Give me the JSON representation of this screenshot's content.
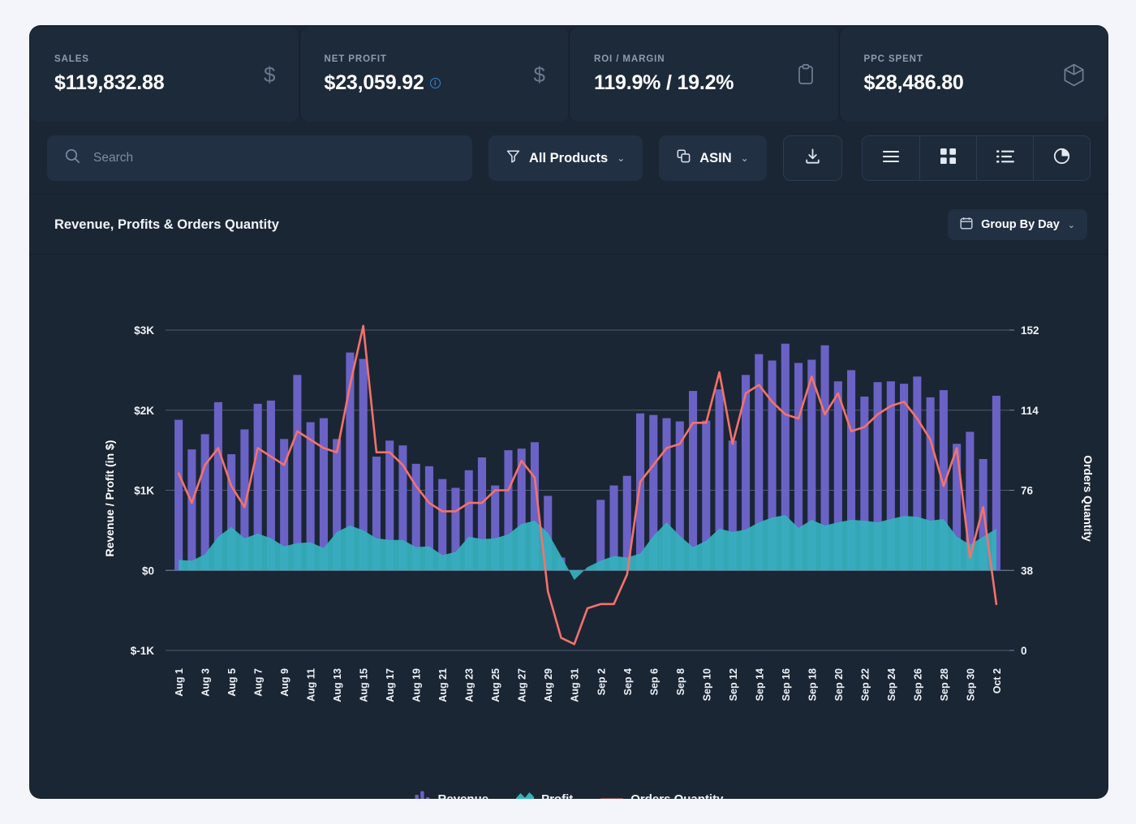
{
  "kpis": [
    {
      "label": "SALES",
      "value": "$119,832.88",
      "icon": "dollar-icon",
      "info": false
    },
    {
      "label": "NET PROFIT",
      "value": "$23,059.92",
      "icon": "dollar-icon",
      "info": true,
      "info_glyph": "i"
    },
    {
      "label": "ROI / MARGIN",
      "value": "119.9% / 19.2%",
      "icon": "clipboard-icon",
      "info": false
    },
    {
      "label": "PPC SPENT",
      "value": "$28,486.80",
      "icon": "box-icon",
      "info": false
    }
  ],
  "toolbar": {
    "search_placeholder": "Search",
    "search_value": "",
    "products_filter": "All Products",
    "asin_filter": "ASIN",
    "chevron": "⌄",
    "download_label": "Download",
    "views": [
      "list-view",
      "grid-view",
      "detail-list-view",
      "pie-chart-view"
    ]
  },
  "chart_header": {
    "title": "Revenue, Profits & Orders Quantity",
    "group_by": "Group By Day",
    "chevron": "⌄"
  },
  "colors": {
    "page_bg": "#f3f5fb",
    "card_bg": "#1b2634",
    "kpi_bg": "#1d2a3a",
    "revenue": "#6b62c6",
    "profit": "#35b2bd",
    "orders": "#f4726c",
    "grid": "#7a8699",
    "text": "#eef2f8",
    "muted": "#8e9cb0",
    "accent_blue": "#2f87d6"
  },
  "chart_data": {
    "type": "bar",
    "title": "Revenue, Profits & Orders Quantity",
    "xlabel": "",
    "ylabel": "Revenue / Profit (in $)",
    "y2label": "Orders Quantity",
    "ylim": [
      -1000,
      3000
    ],
    "y2lim": [
      0,
      152
    ],
    "yticks": [
      3000,
      2000,
      1000,
      0,
      -1000
    ],
    "ytick_labels": [
      "$3K",
      "$2K",
      "$1K",
      "$0",
      "$-1K"
    ],
    "y2ticks": [
      152,
      114,
      76,
      38,
      0
    ],
    "y2tick_labels": [
      "152",
      "114",
      "76",
      "38",
      "0"
    ],
    "grid": true,
    "legend": [
      "Revenue",
      "Profit",
      "Orders Quantity"
    ],
    "legend_position": "bottom",
    "categories": [
      "Aug 1",
      "Aug 2",
      "Aug 3",
      "Aug 4",
      "Aug 5",
      "Aug 6",
      "Aug 7",
      "Aug 8",
      "Aug 9",
      "Aug 10",
      "Aug 11",
      "Aug 12",
      "Aug 13",
      "Aug 14",
      "Aug 15",
      "Aug 16",
      "Aug 17",
      "Aug 18",
      "Aug 19",
      "Aug 20",
      "Aug 21",
      "Aug 22",
      "Aug 23",
      "Aug 24",
      "Aug 25",
      "Aug 26",
      "Aug 27",
      "Aug 28",
      "Aug 29",
      "Aug 30",
      "Aug 31",
      "Sep 1",
      "Sep 2",
      "Sep 3",
      "Sep 4",
      "Sep 5",
      "Sep 6",
      "Sep 7",
      "Sep 8",
      "Sep 9",
      "Sep 10",
      "Sep 11",
      "Sep 12",
      "Sep 13",
      "Sep 14",
      "Sep 15",
      "Sep 16",
      "Sep 17",
      "Sep 18",
      "Sep 19",
      "Sep 20",
      "Sep 21",
      "Sep 22",
      "Sep 23",
      "Sep 24",
      "Sep 25",
      "Sep 26",
      "Sep 27",
      "Sep 28",
      "Sep 29",
      "Sep 30",
      "Oct 1",
      "Oct 2"
    ],
    "tick_labels_shown": [
      "Aug 1",
      "Aug 3",
      "Aug 5",
      "Aug 7",
      "Aug 9",
      "Aug 11",
      "Aug 13",
      "Aug 15",
      "Aug 17",
      "Aug 19",
      "Aug 21",
      "Aug 23",
      "Aug 25",
      "Aug 27",
      "Aug 29",
      "Aug 31",
      "Sep 2",
      "Sep 4",
      "Sep 6",
      "Sep 8",
      "Sep 10",
      "Sep 12",
      "Sep 14",
      "Sep 16",
      "Sep 18",
      "Sep 20",
      "Sep 22",
      "Sep 24",
      "Sep 26",
      "Sep 28",
      "Sep 30",
      "Oct 2"
    ],
    "series": [
      {
        "name": "Revenue",
        "type": "bar",
        "color": "#6b62c6",
        "axis": "left",
        "values": [
          1880,
          1510,
          1700,
          2100,
          1450,
          1760,
          2080,
          2120,
          1640,
          2440,
          1850,
          1900,
          1640,
          2720,
          2640,
          1420,
          1620,
          1560,
          1330,
          1300,
          1140,
          1030,
          1250,
          1410,
          1060,
          1500,
          1520,
          1600,
          930,
          160,
          0,
          0,
          880,
          1060,
          1180,
          1960,
          1940,
          1900,
          1860,
          2240,
          1870,
          2260,
          1620,
          2440,
          2700,
          2620,
          2830,
          2590,
          2630,
          2810,
          2360,
          2500,
          2170,
          2350,
          2360,
          2330,
          2420,
          2160,
          2250,
          1580,
          1730,
          1390,
          2180
        ]
      },
      {
        "name": "Profit",
        "type": "area",
        "color": "#35b2bd",
        "axis": "left",
        "values": [
          130,
          120,
          200,
          420,
          540,
          400,
          460,
          400,
          300,
          340,
          350,
          280,
          480,
          560,
          500,
          400,
          380,
          380,
          290,
          300,
          190,
          230,
          420,
          390,
          400,
          450,
          580,
          620,
          470,
          180,
          -120,
          40,
          120,
          180,
          160,
          210,
          430,
          600,
          430,
          290,
          370,
          520,
          480,
          510,
          600,
          660,
          690,
          530,
          630,
          560,
          600,
          630,
          620,
          600,
          640,
          680,
          670,
          620,
          640,
          420,
          320,
          420,
          520
        ]
      },
      {
        "name": "Orders Quantity",
        "type": "line",
        "color": "#f4726c",
        "axis": "right",
        "values": [
          84,
          70,
          88,
          96,
          78,
          68,
          96,
          92,
          88,
          104,
          100,
          96,
          94,
          126,
          154,
          94,
          94,
          88,
          78,
          70,
          66,
          66,
          70,
          70,
          76,
          76,
          90,
          82,
          28,
          6,
          3,
          20,
          22,
          22,
          36,
          80,
          88,
          96,
          98,
          108,
          108,
          132,
          98,
          122,
          126,
          118,
          112,
          110,
          130,
          112,
          122,
          104,
          106,
          112,
          116,
          118,
          110,
          100,
          78,
          96,
          44,
          68,
          22
        ]
      }
    ]
  }
}
